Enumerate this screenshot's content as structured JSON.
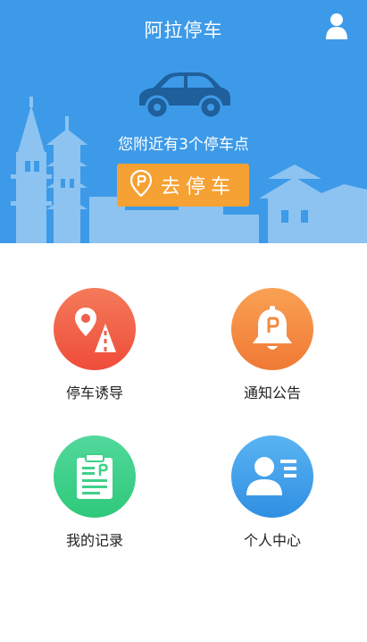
{
  "header": {
    "title": "阿拉停车",
    "user_icon": "user-icon",
    "background": "#3d9ae8"
  },
  "hero": {
    "car_icon": "car-icon",
    "nearby_text": "您附近有3个停车点",
    "go_button": {
      "label": "去停车",
      "icon": "parking-pin-icon",
      "color": "#f6a133"
    }
  },
  "menu": [
    {
      "label": "停车诱导",
      "icon": "map-route-icon",
      "color_top": "#f47a5a",
      "color_bottom": "#ef4c3a"
    },
    {
      "label": "通知公告",
      "icon": "bell-icon",
      "color_top": "#f9a154",
      "color_bottom": "#f07935"
    },
    {
      "label": "我的记录",
      "icon": "clipboard-icon",
      "color_top": "#52d89c",
      "color_bottom": "#2ec97a"
    },
    {
      "label": "个人中心",
      "icon": "id-card-icon",
      "color_top": "#5ab4f2",
      "color_bottom": "#2f8fe2"
    }
  ]
}
